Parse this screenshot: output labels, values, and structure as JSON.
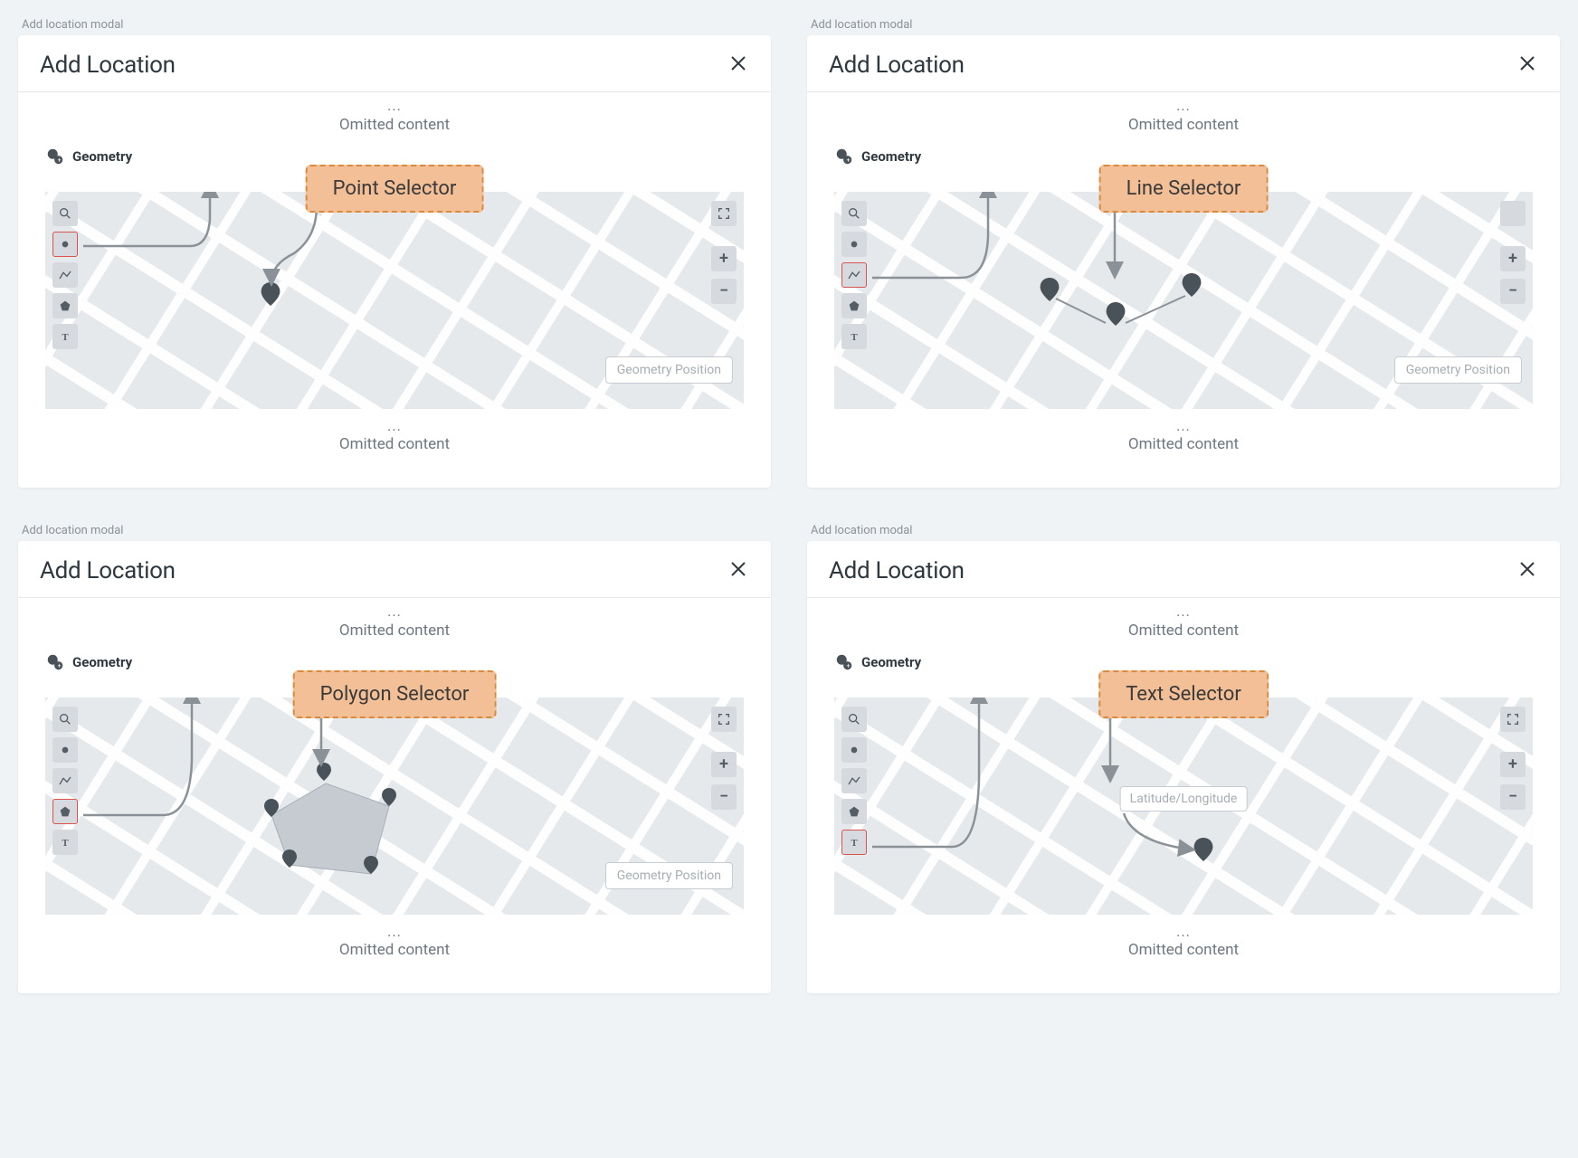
{
  "panels": [
    {
      "caption": "Add location modal",
      "title": "Add Location",
      "ellipsis": "...",
      "omitted": "Omitted content",
      "section": "Geometry",
      "selector": "Point Selector",
      "geom_position": "Geometry Position",
      "selected_tool_name": "point"
    },
    {
      "caption": "Add location modal",
      "title": "Add Location",
      "ellipsis": "...",
      "omitted": "Omitted content",
      "section": "Geometry",
      "selector": "Line Selector",
      "geom_position": "Geometry Position",
      "selected_tool_name": "line"
    },
    {
      "caption": "Add location modal",
      "title": "Add Location",
      "ellipsis": "...",
      "omitted": "Omitted content",
      "section": "Geometry",
      "selector": "Polygon Selector",
      "geom_position": "Geometry Position",
      "selected_tool_name": "polygon"
    },
    {
      "caption": "Add location modal",
      "title": "Add Location",
      "ellipsis": "...",
      "omitted": "Omitted content",
      "section": "Geometry",
      "selector": "Text Selector",
      "latlng_placeholder": "Latitude/Longitude",
      "selected_tool_name": "text"
    }
  ],
  "controls": {
    "plus": "+",
    "minus": "−"
  }
}
